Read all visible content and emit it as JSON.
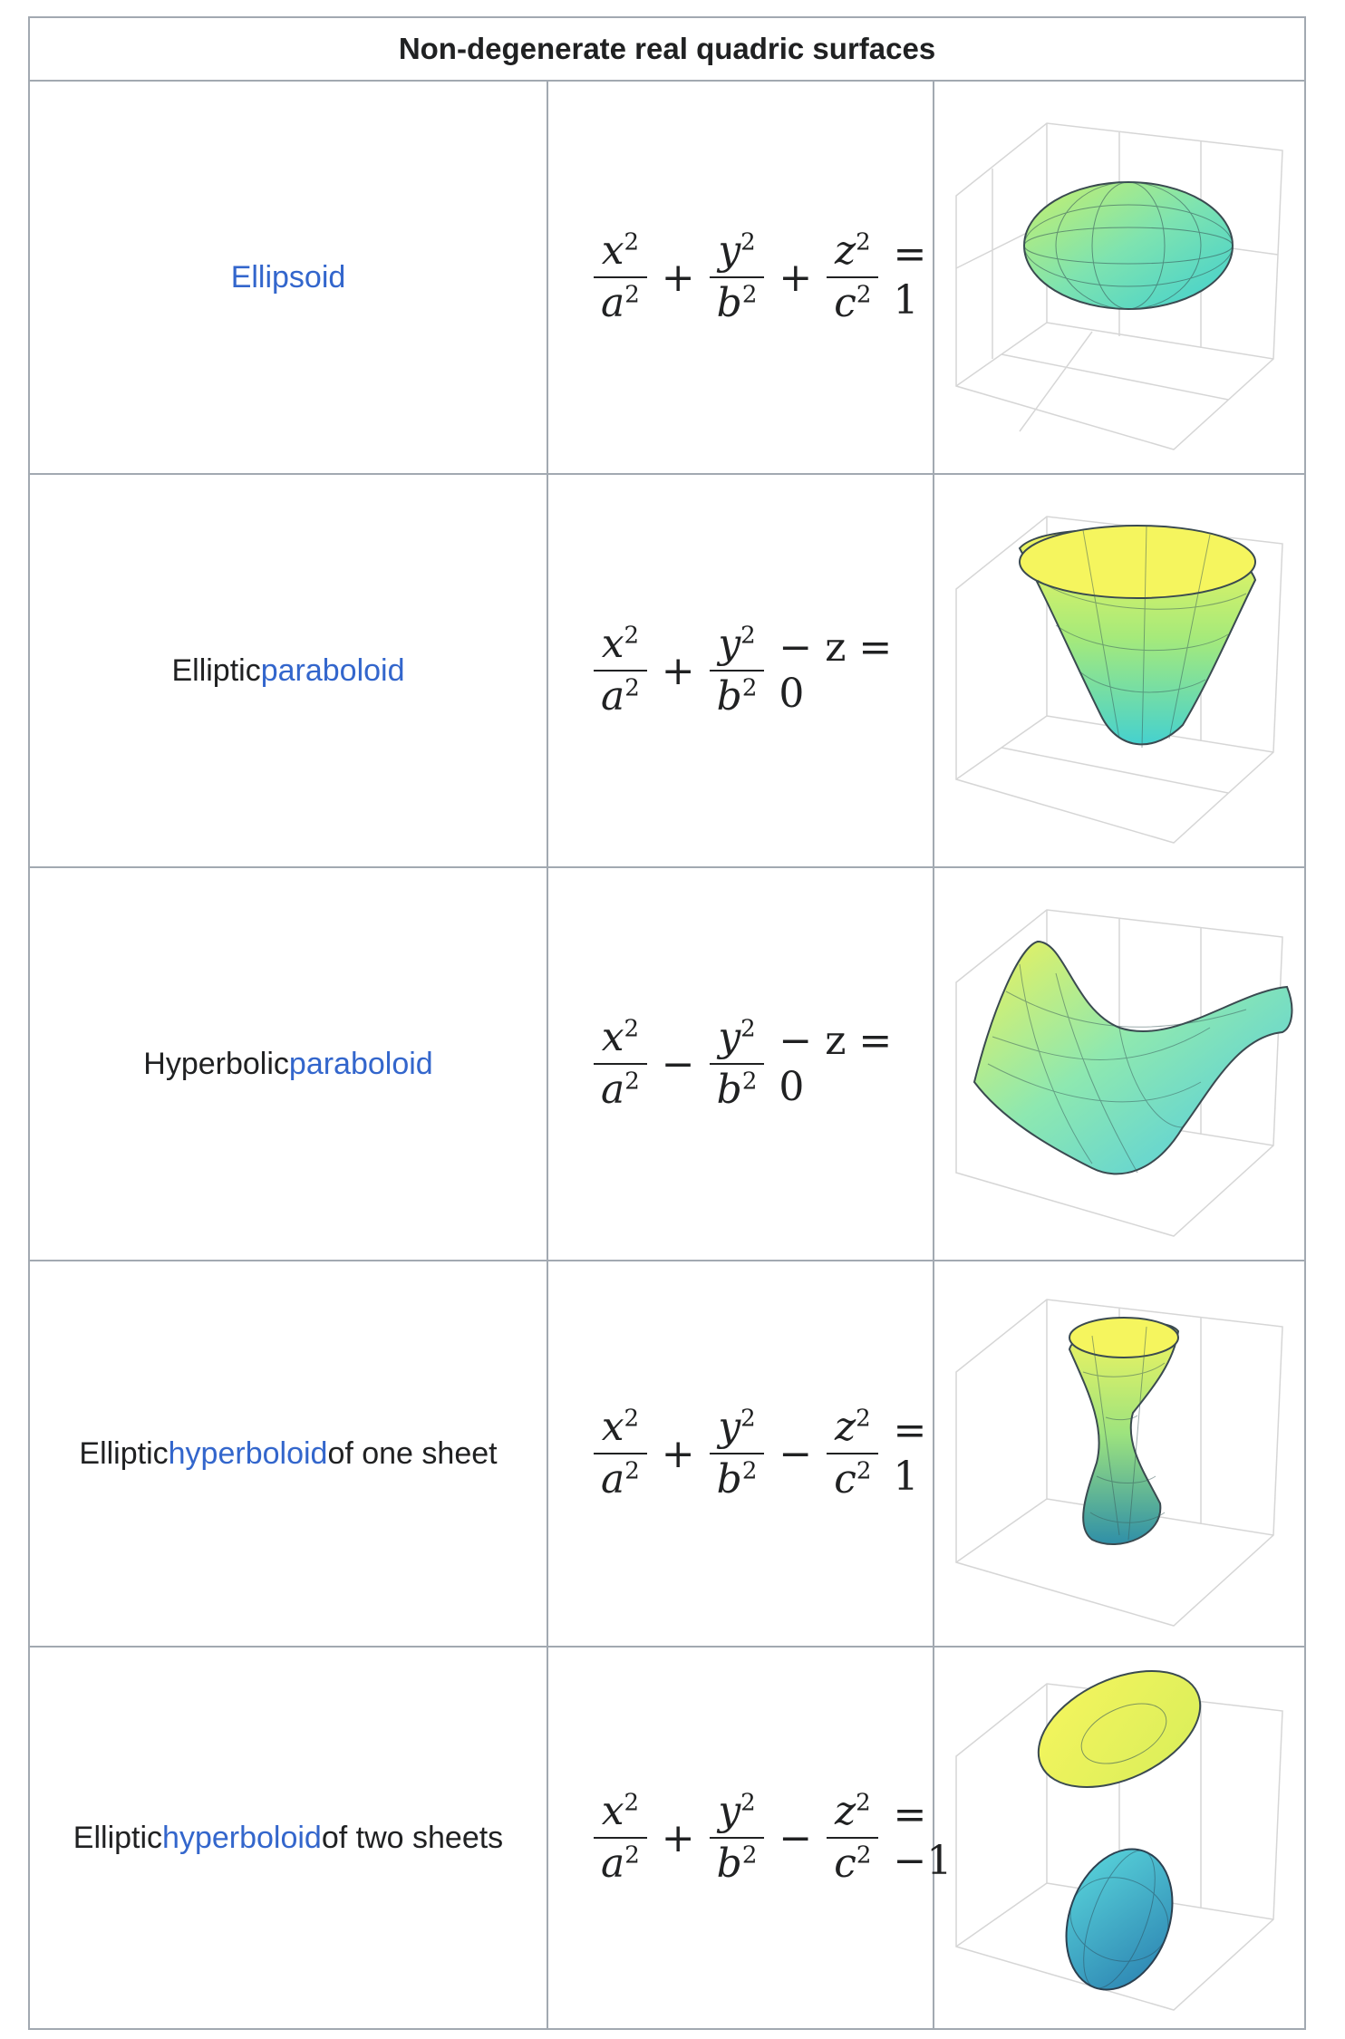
{
  "table": {
    "header": "Non-degenerate real quadric surfaces",
    "rows": [
      {
        "name": {
          "pre": "",
          "link": "Ellipsoid",
          "post": ""
        },
        "formula": {
          "t1": "x",
          "t1e": "2",
          "d1": "a",
          "d1e": "2",
          "op1": "+",
          "t2": "y",
          "t2e": "2",
          "d2": "b",
          "d2e": "2",
          "op2": "+",
          "t3": "z",
          "t3e": "2",
          "d3": "c",
          "d3e": "2",
          "eq": "= 1"
        },
        "plot_icon": "ellipsoid-surface-plot"
      },
      {
        "name": {
          "pre": "Elliptic ",
          "link": "paraboloid",
          "post": ""
        },
        "formula": {
          "t1": "x",
          "t1e": "2",
          "d1": "a",
          "d1e": "2",
          "op1": "+",
          "t2": "y",
          "t2e": "2",
          "d2": "b",
          "d2e": "2",
          "tail": "− z = 0"
        },
        "plot_icon": "elliptic-paraboloid-surface-plot"
      },
      {
        "name": {
          "pre": "Hyperbolic ",
          "link": "paraboloid",
          "post": ""
        },
        "formula": {
          "t1": "x",
          "t1e": "2",
          "d1": "a",
          "d1e": "2",
          "op1": "−",
          "t2": "y",
          "t2e": "2",
          "d2": "b",
          "d2e": "2",
          "tail": "− z = 0"
        },
        "plot_icon": "hyperbolic-paraboloid-surface-plot"
      },
      {
        "name": {
          "pre": "Elliptic ",
          "link": "hyperboloid",
          "post": " of one sheet"
        },
        "formula": {
          "t1": "x",
          "t1e": "2",
          "d1": "a",
          "d1e": "2",
          "op1": "+",
          "t2": "y",
          "t2e": "2",
          "d2": "b",
          "d2e": "2",
          "op2": "−",
          "t3": "z",
          "t3e": "2",
          "d3": "c",
          "d3e": "2",
          "eq": "= 1"
        },
        "plot_icon": "hyperboloid-one-sheet-surface-plot"
      },
      {
        "name": {
          "pre": "Elliptic ",
          "link": "hyperboloid",
          "post": " of two sheets"
        },
        "formula": {
          "t1": "x",
          "t1e": "2",
          "d1": "a",
          "d1e": "2",
          "op1": "+",
          "t2": "y",
          "t2e": "2",
          "d2": "b",
          "d2e": "2",
          "op2": "−",
          "t3": "z",
          "t3e": "2",
          "d3": "c",
          "d3e": "2",
          "eq": "= −1"
        },
        "plot_icon": "hyperboloid-two-sheets-surface-plot"
      }
    ]
  },
  "colors": {
    "link": "#3366cc",
    "border": "#a2a9b1",
    "text": "#202122",
    "surface_yellow": "#f2f25a",
    "surface_cyan": "#4fd6d6"
  }
}
